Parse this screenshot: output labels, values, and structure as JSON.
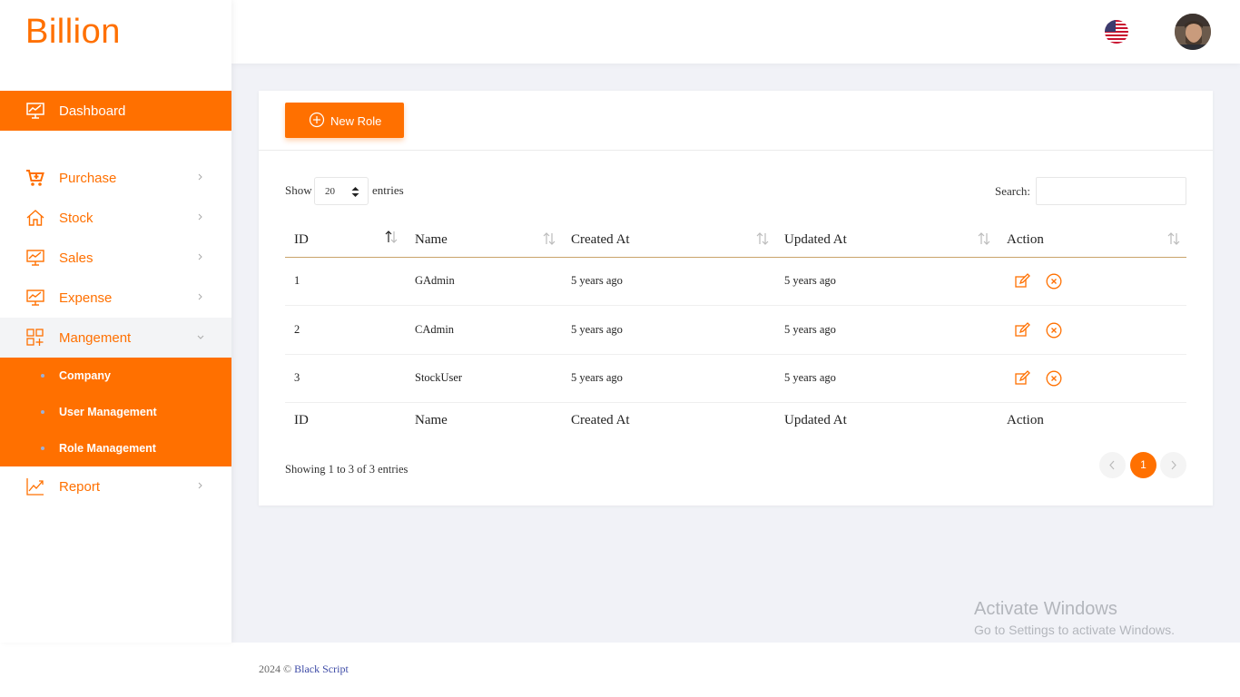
{
  "brand": {
    "logo_text": "Billion",
    "accent": "#ff7000"
  },
  "sidebar": {
    "items": [
      {
        "label": "Dashboard",
        "icon": "chart-board-icon",
        "active": true
      },
      {
        "label": "Purchase",
        "icon": "cart-plus-icon"
      },
      {
        "label": "Stock",
        "icon": "home-icon"
      },
      {
        "label": "Sales",
        "icon": "chart-board-icon"
      },
      {
        "label": "Expense",
        "icon": "chart-board-icon"
      },
      {
        "label": "Mangement",
        "icon": "grid-plus-icon",
        "expanded": true
      },
      {
        "label": "Report",
        "icon": "trend-chart-icon"
      }
    ],
    "submenu": [
      {
        "label": "Company"
      },
      {
        "label": "User Management"
      },
      {
        "label": "Role Management"
      }
    ]
  },
  "header": {
    "language_icon": "us-flag-icon",
    "avatar": "user-avatar"
  },
  "toolbar": {
    "new_role_label": "New Role"
  },
  "table_controls": {
    "show_label": "Show",
    "page_size": "20",
    "entries_label": "entries",
    "search_label": "Search:",
    "search_value": ""
  },
  "table": {
    "columns": [
      "ID",
      "Name",
      "Created At",
      "Updated At",
      "Action"
    ],
    "rows": [
      {
        "id": "1",
        "name": "GAdmin",
        "created": "5 years ago",
        "updated": "5 years ago"
      },
      {
        "id": "2",
        "name": "CAdmin",
        "created": "5 years ago",
        "updated": "5 years ago"
      },
      {
        "id": "3",
        "name": "StockUser",
        "created": "5 years ago",
        "updated": "5 years ago"
      }
    ],
    "footer_columns": [
      "ID",
      "Name",
      "Created At",
      "Updated At",
      "Action"
    ]
  },
  "pagination": {
    "info": "Showing 1 to 3 of 3 entries",
    "current_page": "1"
  },
  "watermark": {
    "line1": "Activate Windows",
    "line2": "Go to Settings to activate Windows."
  },
  "footer": {
    "year_text": "2024 © ",
    "link_text": "Black Script"
  }
}
